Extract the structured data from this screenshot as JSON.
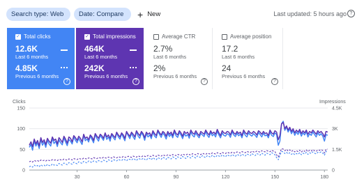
{
  "filters": {
    "search_type": "Search type: Web",
    "date": "Date: Compare",
    "new_label": "New"
  },
  "last_updated": "Last updated: 5 hours ago",
  "help_icon": "?",
  "metrics": {
    "clicks": {
      "label": "Total clicks",
      "current": "12.6K",
      "current_label": "Last 6 months",
      "previous": "4.85K",
      "previous_label": "Previous 6 months",
      "selected": true,
      "color": "#4285f4"
    },
    "impressions": {
      "label": "Total impressions",
      "current": "464K",
      "current_label": "Last 6 months",
      "previous": "242K",
      "previous_label": "Previous 6 months",
      "selected": true,
      "color": "#5e35b1"
    },
    "ctr": {
      "label": "Average CTR",
      "current": "2.7%",
      "current_label": "Last 6 months",
      "previous": "2%",
      "previous_label": "Previous 6 months",
      "selected": false
    },
    "position": {
      "label": "Average position",
      "current": "17.2",
      "current_label": "Last 6 months",
      "previous": "24",
      "previous_label": "Previous 6 months",
      "selected": false
    }
  },
  "chart_data": {
    "type": "line",
    "left_axis_title": "Clicks",
    "right_axis_title": "Impressions",
    "left_ticks": [
      "150",
      "100",
      "50",
      "0"
    ],
    "right_ticks": [
      "4.5K",
      "3K",
      "1.5K",
      "0"
    ],
    "ylim_left": [
      0,
      150
    ],
    "ylim_right": [
      0,
      4500
    ],
    "x_ticks": [
      "30",
      "60",
      "90",
      "120",
      "150",
      "180"
    ],
    "xlim": [
      1,
      182
    ],
    "grid": true,
    "series": [
      {
        "axis": "left",
        "style": "solid",
        "color": "#4285f4",
        "values": [
          55,
          62,
          48,
          70,
          58,
          66,
          52,
          74,
          60,
          68,
          55,
          72,
          63,
          58,
          76,
          64,
          70,
          57,
          73,
          66,
          61,
          78,
          68,
          59,
          74,
          70,
          63,
          80,
          72,
          66,
          77,
          69,
          62,
          84,
          71,
          75,
          68,
          82,
          74,
          66,
          86,
          76,
          70,
          84,
          78,
          72,
          88,
          74,
          80,
          70,
          86,
          78,
          73,
          90,
          80,
          75,
          88,
          79,
          71,
          92,
          83,
          76,
          89,
          80,
          74,
          93,
          82,
          77,
          90,
          84,
          72,
          88,
          80,
          85,
          76,
          92,
          82,
          78,
          94,
          86,
          79,
          90,
          84,
          75,
          89,
          81,
          87,
          78,
          93,
          83,
          79,
          91,
          85,
          76,
          88,
          82,
          86,
          77,
          92,
          84,
          80,
          90,
          83,
          78,
          89,
          85,
          81,
          93,
          84,
          79,
          91,
          83,
          87,
          80,
          94,
          85,
          78,
          90,
          84,
          82,
          88,
          86,
          79,
          93,
          85,
          81,
          89,
          83,
          87,
          78,
          92,
          84,
          80,
          90,
          85,
          82,
          88,
          84,
          79,
          91,
          86,
          80,
          89,
          83,
          85,
          78,
          92,
          84,
          81,
          90,
          86,
          60,
          70,
          112,
          118,
          96,
          104,
          92,
          100,
          88,
          96,
          84,
          92,
          86,
          94,
          82,
          90,
          85,
          93,
          80,
          88,
          84,
          92,
          86,
          80,
          90,
          84,
          88,
          82,
          70,
          86,
          84
        ]
      },
      {
        "axis": "right",
        "style": "solid",
        "color": "#5e35b1",
        "values": [
          1800,
          2050,
          1700,
          2250,
          1900,
          2150,
          1750,
          2350,
          2000,
          2200,
          1850,
          2300,
          2100,
          1950,
          2400,
          2150,
          2250,
          1900,
          2350,
          2200,
          2000,
          2450,
          2250,
          1950,
          2400,
          2300,
          2050,
          2500,
          2350,
          2150,
          2450,
          2300,
          2050,
          2600,
          2300,
          2400,
          2200,
          2550,
          2400,
          2150,
          2650,
          2450,
          2300,
          2600,
          2500,
          2300,
          2700,
          2400,
          2550,
          2300,
          2650,
          2500,
          2350,
          2750,
          2550,
          2400,
          2700,
          2550,
          2300,
          2800,
          2600,
          2450,
          2750,
          2600,
          2400,
          2850,
          2650,
          2500,
          2800,
          2650,
          2350,
          2750,
          2600,
          2700,
          2450,
          2850,
          2650,
          2500,
          2900,
          2700,
          2550,
          2800,
          2700,
          2450,
          2800,
          2600,
          2750,
          2500,
          2900,
          2650,
          2550,
          2850,
          2700,
          2450,
          2800,
          2650,
          2750,
          2500,
          2900,
          2700,
          2600,
          2850,
          2650,
          2500,
          2800,
          2700,
          2600,
          2900,
          2700,
          2550,
          2850,
          2650,
          2750,
          2600,
          2950,
          2700,
          2500,
          2850,
          2700,
          2650,
          2800,
          2750,
          2550,
          2900,
          2700,
          2600,
          2800,
          2650,
          2750,
          2500,
          2900,
          2700,
          2600,
          2850,
          2700,
          2650,
          2800,
          2700,
          2550,
          2850,
          2750,
          2600,
          2800,
          2650,
          2700,
          2500,
          2900,
          2700,
          2600,
          2850,
          2750,
          2200,
          2500,
          3350,
          3450,
          3000,
          3200,
          2900,
          3100,
          2800,
          3000,
          2700,
          2900,
          2750,
          2950,
          2650,
          2850,
          2700,
          2900,
          2600,
          2800,
          2700,
          2900,
          2750,
          2600,
          2850,
          2700,
          2800,
          2650,
          2400,
          2800,
          2750
        ]
      },
      {
        "axis": "left",
        "style": "dashed",
        "color": "#4285f4",
        "values": [
          8,
          10,
          7,
          12,
          9,
          11,
          8,
          13,
          10,
          12,
          9,
          14,
          11,
          10,
          15,
          12,
          13,
          11,
          16,
          14,
          12,
          17,
          15,
          13,
          18,
          16,
          14,
          19,
          17,
          15,
          20,
          18,
          16,
          21,
          19,
          17,
          22,
          20,
          18,
          22,
          21,
          19,
          23,
          21,
          20,
          24,
          22,
          20,
          25,
          23,
          21,
          25,
          24,
          22,
          26,
          24,
          23,
          27,
          25,
          22,
          27,
          26,
          24,
          28,
          26,
          23,
          28,
          27,
          25,
          29,
          26,
          24,
          29,
          28,
          25,
          30,
          27,
          25,
          30,
          28,
          26,
          31,
          29,
          26,
          31,
          29,
          27,
          32,
          30,
          27,
          32,
          30,
          28,
          33,
          30,
          28,
          33,
          31,
          29,
          34,
          31,
          29,
          34,
          32,
          30,
          35,
          32,
          30,
          35,
          33,
          31,
          36,
          33,
          31,
          36,
          34,
          32,
          37,
          34,
          32,
          37,
          35,
          33,
          38,
          35,
          33,
          38,
          36,
          34,
          39,
          36,
          34,
          39,
          37,
          35,
          40,
          37,
          35,
          40,
          38,
          36,
          41,
          38,
          36,
          41,
          39,
          37,
          42,
          40,
          37,
          30,
          25,
          35,
          45,
          44,
          40,
          43,
          39,
          42,
          38,
          41,
          37,
          40,
          38,
          42,
          37,
          41,
          39,
          43,
          38,
          42,
          40,
          44,
          41,
          39,
          43,
          42,
          44,
          41,
          36,
          45,
          46
        ]
      },
      {
        "axis": "right",
        "style": "dashed",
        "color": "#5e35b1",
        "values": [
          600,
          650,
          580,
          700,
          640,
          690,
          620,
          730,
          680,
          710,
          650,
          740,
          700,
          670,
          760,
          720,
          740,
          690,
          780,
          750,
          710,
          800,
          760,
          720,
          810,
          780,
          740,
          830,
          800,
          760,
          850,
          810,
          780,
          870,
          830,
          800,
          880,
          850,
          810,
          900,
          860,
          830,
          910,
          880,
          840,
          930,
          890,
          860,
          940,
          910,
          870,
          960,
          920,
          880,
          970,
          930,
          900,
          990,
          940,
          910,
          1000,
          960,
          920,
          1010,
          970,
          940,
          1030,
          980,
          950,
          1040,
          1000,
          960,
          1060,
          1010,
          980,
          1070,
          1030,
          990,
          1090,
          1040,
          1010,
          1100,
          1060,
          1020,
          1110,
          1070,
          1040,
          1130,
          1080,
          1050,
          1140,
          1100,
          1060,
          1160,
          1110,
          1080,
          1170,
          1130,
          1090,
          1190,
          1140,
          1110,
          1200,
          1160,
          1120,
          1220,
          1170,
          1140,
          1230,
          1190,
          1150,
          1250,
          1200,
          1170,
          1260,
          1220,
          1180,
          1280,
          1230,
          1200,
          1290,
          1250,
          1210,
          1310,
          1260,
          1230,
          1320,
          1280,
          1240,
          1340,
          1290,
          1260,
          1350,
          1310,
          1270,
          1370,
          1320,
          1290,
          1380,
          1340,
          1300,
          1400,
          1350,
          1320,
          1410,
          1370,
          1330,
          1430,
          1380,
          1350,
          1100,
          950,
          1250,
          1550,
          1520,
          1400,
          1500,
          1380,
          1460,
          1350,
          1430,
          1320,
          1400,
          1340,
          1440,
          1310,
          1420,
          1360,
          1460,
          1330,
          1440,
          1380,
          1480,
          1400,
          1350,
          1460,
          1430,
          1490,
          1410,
          1250,
          1500,
          1520
        ]
      }
    ]
  }
}
